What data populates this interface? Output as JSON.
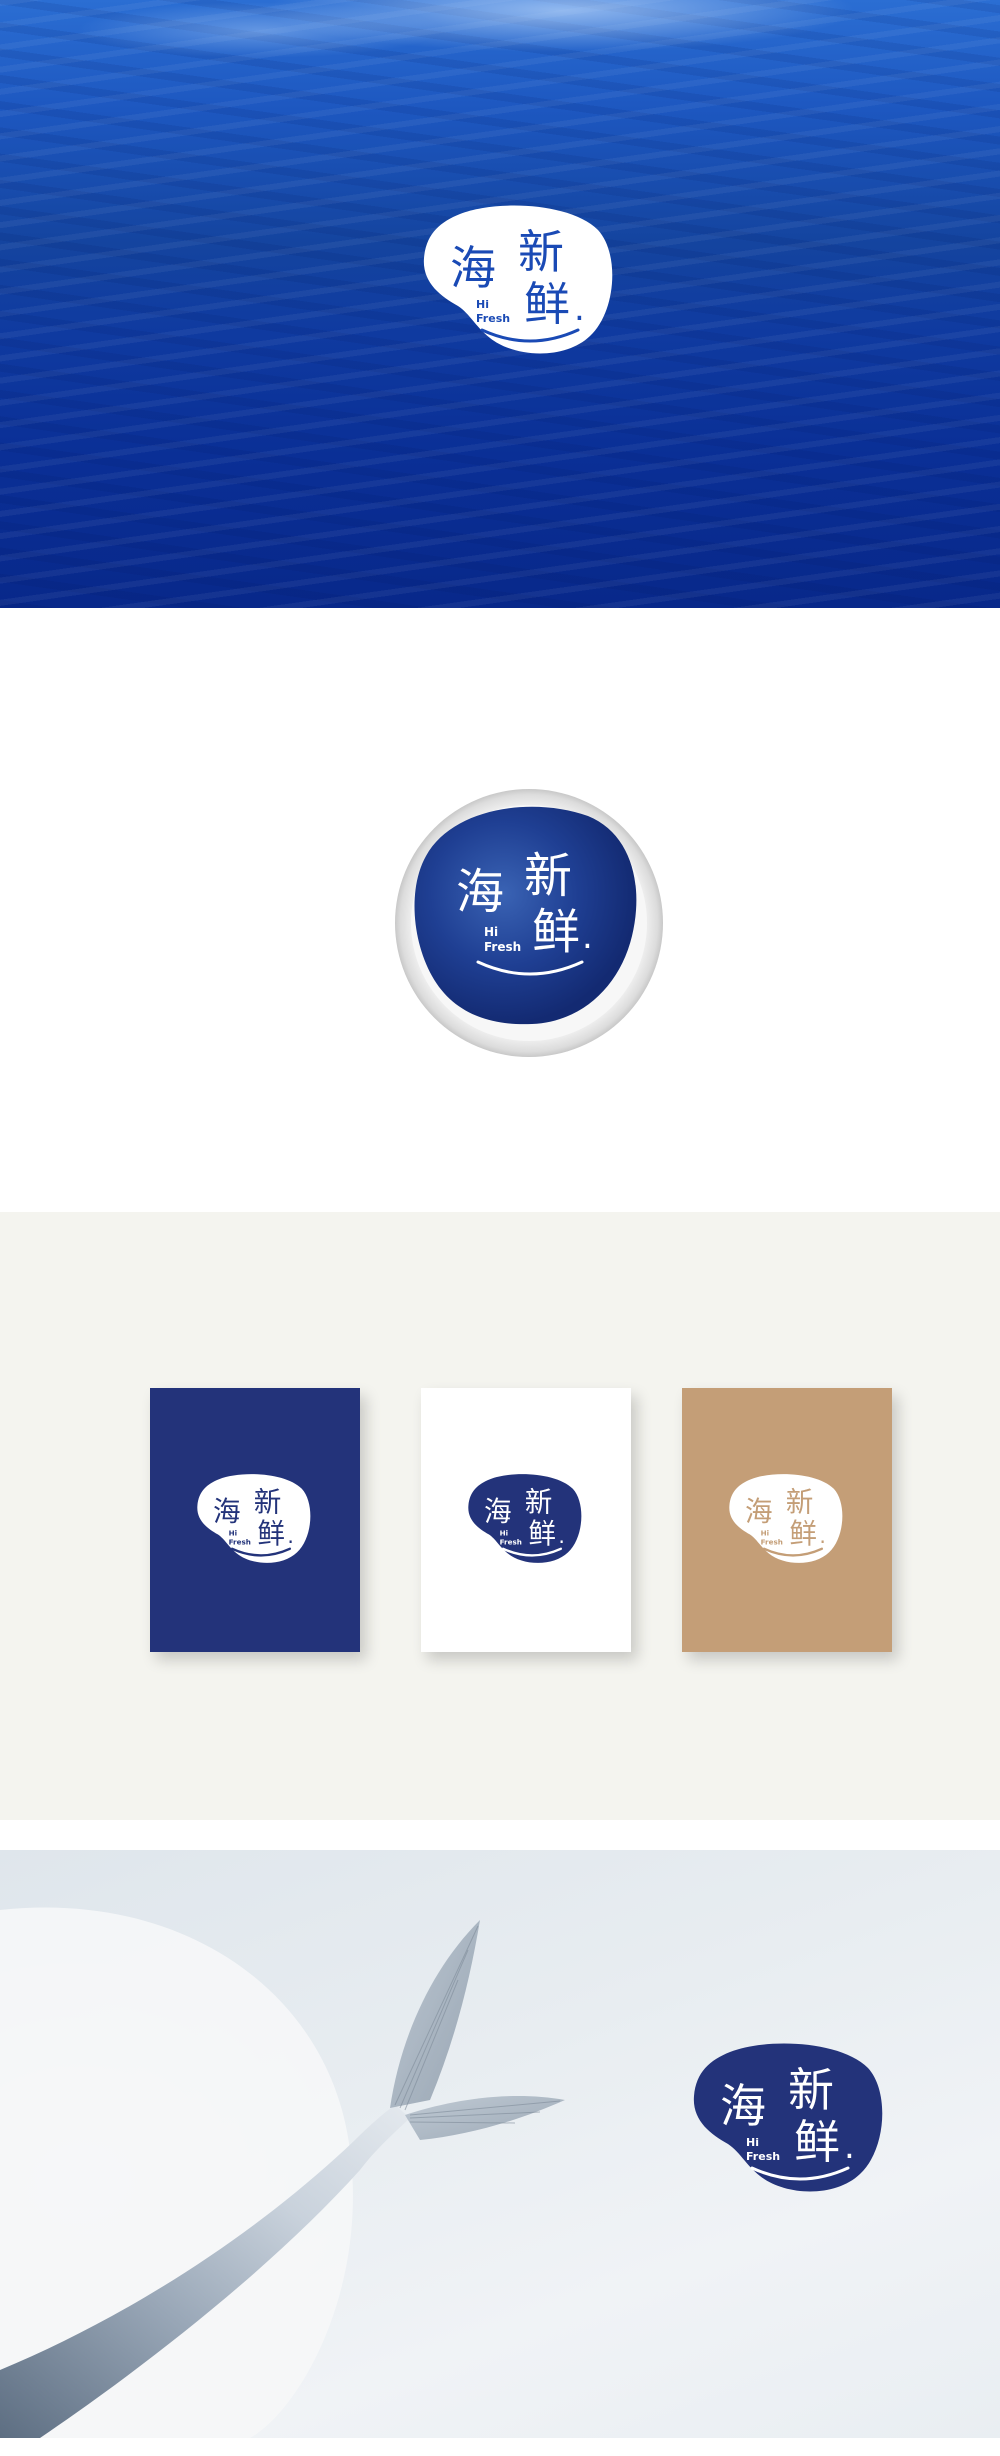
{
  "brand": {
    "name_cn": "海新鲜",
    "char_1": "海",
    "char_2": "新",
    "char_3": "鲜",
    "dot": ".",
    "tagline_line1": "Hi",
    "tagline_line2": "Fresh"
  },
  "colors": {
    "navy": "#23337a",
    "ocean_blue": "#0f3aa0",
    "tan": "#c49e77",
    "cream_background": "#f4f4ef",
    "white": "#ffffff"
  }
}
